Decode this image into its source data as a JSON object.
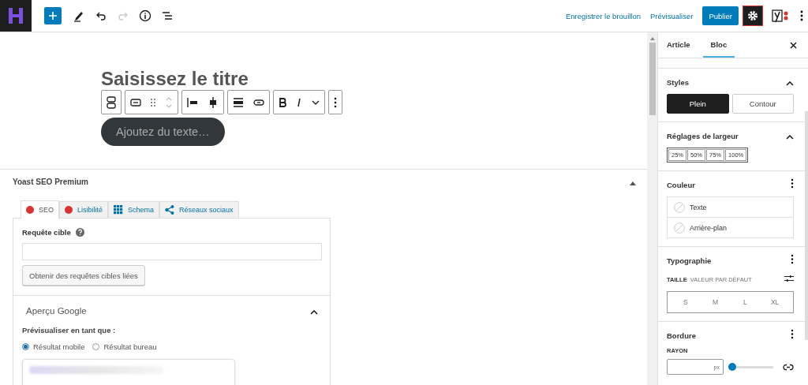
{
  "topbar": {
    "actions": [
      "Enregistrer le brouillon",
      "Prévisualiser"
    ],
    "publish": "Publier",
    "settings_selected": true
  },
  "editor": {
    "title_placeholder": "Saisissez le titre",
    "button_placeholder": "Ajoutez du texte…"
  },
  "yoast": {
    "title": "Yoast SEO Premium",
    "expanded": true,
    "tabs": [
      {
        "label": "SEO",
        "kind": "dot",
        "color": "#dc3232",
        "selected": true
      },
      {
        "label": "Lisibilité",
        "kind": "dot",
        "color": "#dc3232",
        "selected": false
      },
      {
        "label": "Schema",
        "kind": "grid",
        "selected": false
      },
      {
        "label": "Réseaux sociaux",
        "kind": "share",
        "selected": false
      }
    ],
    "focus_label": "Requête cible",
    "related_button": "Obtenir des requêtes cibles liées",
    "google_preview": {
      "title": "Aperçu Google",
      "expanded": true,
      "preview_as": "Prévisualiser en tant que :",
      "modes": [
        {
          "label": "Résultat mobile",
          "selected": true
        },
        {
          "label": "Résultat bureau",
          "selected": false
        }
      ]
    }
  },
  "sidebar": {
    "tabs": [
      {
        "label": "Article",
        "selected": false
      },
      {
        "label": "Bloc",
        "selected": true
      }
    ],
    "styles": {
      "title": "Styles",
      "expanded": true,
      "options": [
        {
          "label": "Plein",
          "selected": true
        },
        {
          "label": "Contour",
          "selected": false
        }
      ]
    },
    "width": {
      "title": "Réglages de largeur",
      "expanded": true,
      "options": [
        {
          "label": "25%",
          "selected": false
        },
        {
          "label": "50%",
          "selected": false
        },
        {
          "label": "75%",
          "selected": false
        },
        {
          "label": "100%",
          "selected": false
        }
      ]
    },
    "color": {
      "title": "Couleur",
      "items": [
        "Texte",
        "Arrière-plan"
      ]
    },
    "typography": {
      "title": "Typographie",
      "size_label": "TAILLE",
      "size_value": "VALEUR PAR DÉFAUT",
      "sizes": [
        "S",
        "M",
        "L",
        "XL"
      ]
    },
    "border": {
      "title": "Bordure",
      "radius_label": "RAYON",
      "unit": "px",
      "level": 0
    }
  }
}
